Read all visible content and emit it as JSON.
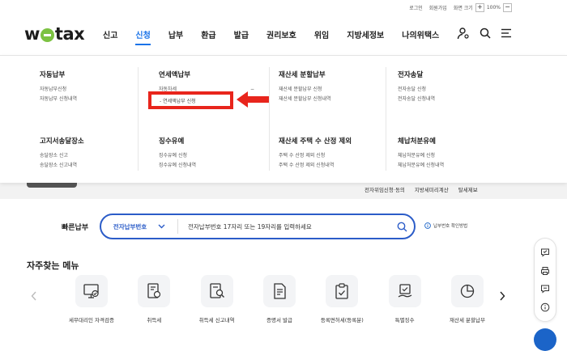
{
  "util": {
    "login": "로그인",
    "signup": "회원가입",
    "screen_size": "화면 크기",
    "zoom_in": "+",
    "zoom": "100%",
    "zoom_out": "−"
  },
  "logo": {
    "pre": "w",
    "post": "tax"
  },
  "nav": [
    "신고",
    "신청",
    "납부",
    "환급",
    "발급",
    "권리보호",
    "위임",
    "지방세정보",
    "나의위택스"
  ],
  "menu": {
    "columns": [
      {
        "title": "자동납부",
        "items": [
          "자동납부신청",
          "자동납부 신청내역"
        ]
      },
      {
        "title": "연세액납부",
        "items": [
          "자동차세"
        ],
        "collapse": "−"
      },
      {
        "title": "재산세 분할납부",
        "items": [
          "재산세 분할납부 신청",
          "재산세 분할납부 신청내역"
        ]
      },
      {
        "title": "전자송달",
        "items": [
          "전자송달 신청",
          "전자송달 신청내역"
        ]
      },
      {
        "title": "고지서송달장소",
        "items": [
          "송달장소 신고",
          "송달장소 신고내역"
        ]
      },
      {
        "title": "징수유예",
        "items": [
          "징수유예 신청",
          "징수유예 신청내역"
        ]
      },
      {
        "title": "재산세 주택 수 산정 제외",
        "items": [
          "주택 수 산정 제외 신청",
          "주택 수 산정 제외 신청내역"
        ]
      },
      {
        "title": "체납처분유예",
        "items": [
          "체납처분유예 신청",
          "체납처분유예 신청내역"
        ]
      }
    ],
    "highlight": "- 연세액납부 신청"
  },
  "quicklinks": [
    "전자위임신청·동의",
    "지방세미리계산",
    "탈세제보"
  ],
  "quickpay": {
    "label": "빠른납부",
    "select": "전자납부번호",
    "placeholder": "전자납부번호 17자리 또는 19자리를 입력하세요",
    "help": "납부번호 확인방법"
  },
  "faq": {
    "title": "자주찾는 메뉴",
    "items": [
      "세무대리인 자격검증",
      "취득세",
      "취득세 신고내역",
      "증명서 발급",
      "등록면허세(등록분)",
      "특별징수",
      "재산세 분할납부"
    ]
  },
  "colors": {
    "accent": "#1a73e8",
    "highlight": "#e8251c",
    "logo_dot": "#7cc242"
  }
}
